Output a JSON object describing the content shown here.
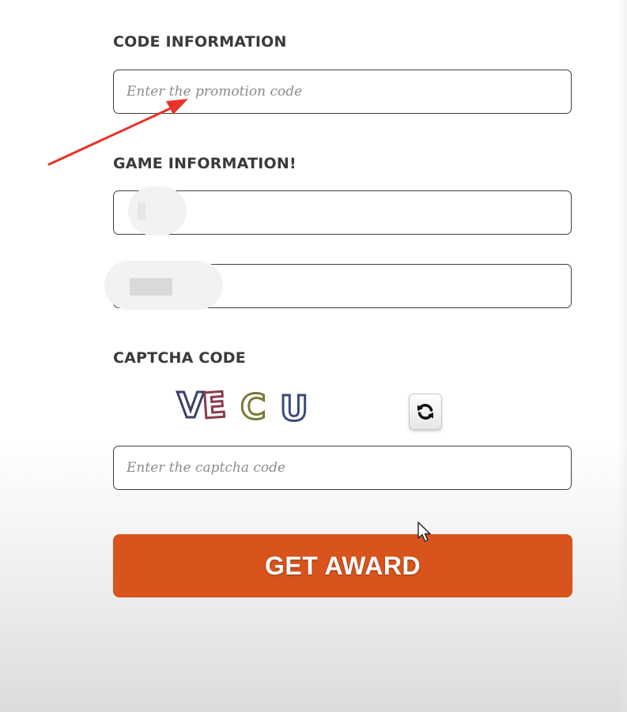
{
  "code_section": {
    "label": "CODE INFORMATION",
    "promo_placeholder": "Enter the promotion code"
  },
  "game_section": {
    "label": "GAME INFORMATION!",
    "field1_placeholder": "",
    "field2_placeholder": ""
  },
  "captcha_section": {
    "label": "CAPTCHA CODE",
    "captcha_text": "VECU",
    "captcha_letters": [
      {
        "char": "V",
        "color": "#3b3f6b"
      },
      {
        "char": "E",
        "color": "#8a3a4a"
      },
      {
        "char": "C",
        "color": "#7a7a3a"
      },
      {
        "char": "U",
        "color": "#3b4a7a"
      }
    ],
    "refresh_icon": "refresh-icon",
    "input_placeholder": "Enter the captcha code"
  },
  "submit": {
    "label": "GET AWARD"
  },
  "colors": {
    "accent": "#d9531c",
    "annotation_arrow": "#e8322a"
  }
}
